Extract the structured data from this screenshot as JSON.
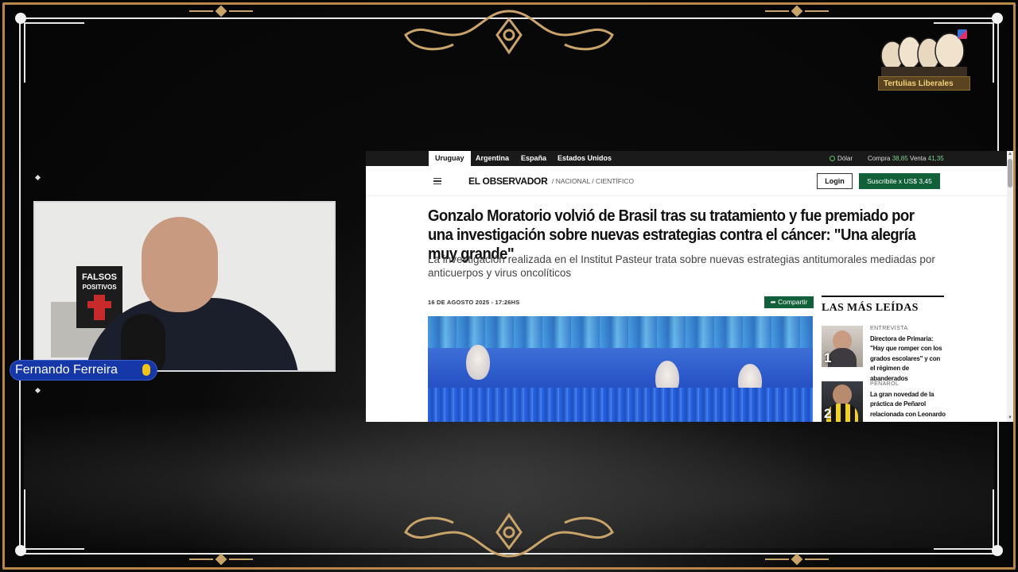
{
  "overlay": {
    "logo_label": "Tertulias Liberales",
    "presenter_name": "Fernando Ferreira",
    "book_title": "FALSOS",
    "book_subtitle": "POSITIVOS"
  },
  "browser": {
    "country_tabs": [
      "Uruguay",
      "Argentina",
      "España",
      "Estados Unidos"
    ],
    "active_tab": "Uruguay",
    "currency": {
      "label": "Dólar",
      "buy_label": "Compra",
      "buy_value": "38,85",
      "sell_label": "Venta",
      "sell_value": "41,35"
    },
    "brand": "EL OBSERVADOR",
    "breadcrumb": "/  NACIONAL  / CIENTÍFICO",
    "login_label": "Login",
    "subscribe_label": "Suscribite x US$ 3,45"
  },
  "article": {
    "headline": "Gonzalo Moratorio volvió de Brasil tras su tratamiento y fue premiado por una investigación sobre nuevas estrategias contra el cáncer: \"Una alegría muy grande\"",
    "lede": "La investigación realizada en el Institut Pasteur trata sobre nuevas estrategias antitumorales mediadas por anticuerpos y virus oncolíticos",
    "date": "16 DE AGOSTO 2025 - 17:26HS",
    "share_label": "Compartir"
  },
  "sidebar": {
    "title": "LAS MÁS LEÍDAS",
    "items": [
      {
        "rank": "1",
        "category": "ENTREVISTA",
        "title": "Directora de Primaria: \"Hay que romper con los grados escolares\" y con el régimen de abanderados"
      },
      {
        "rank": "2",
        "category": "PEÑAROL",
        "title": "La gran novedad de la práctica de Peñarol relacionada con Leonardo"
      }
    ]
  },
  "colors": {
    "frame_gold": "#b8884a",
    "brand_green": "#11603a",
    "name_tag_blue": "#1637a8"
  }
}
